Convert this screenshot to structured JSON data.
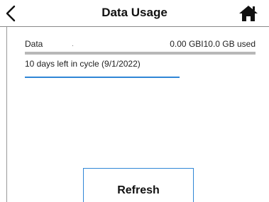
{
  "header": {
    "title": "Data Usage",
    "back_icon": "chevron-left-icon",
    "home_icon": "home-icon"
  },
  "usage": {
    "label": "Data",
    "amount": "0.00 GBI10.0 GB used",
    "used_fraction": 0.0
  },
  "cycle": {
    "text": "10 days left in cycle (9/1/2022)",
    "elapsed_fraction": 0.67
  },
  "actions": {
    "refresh_label": "Refresh"
  },
  "colors": {
    "accent": "#2f86d6",
    "bar_track": "#b8b8b8",
    "text": "#111111"
  }
}
